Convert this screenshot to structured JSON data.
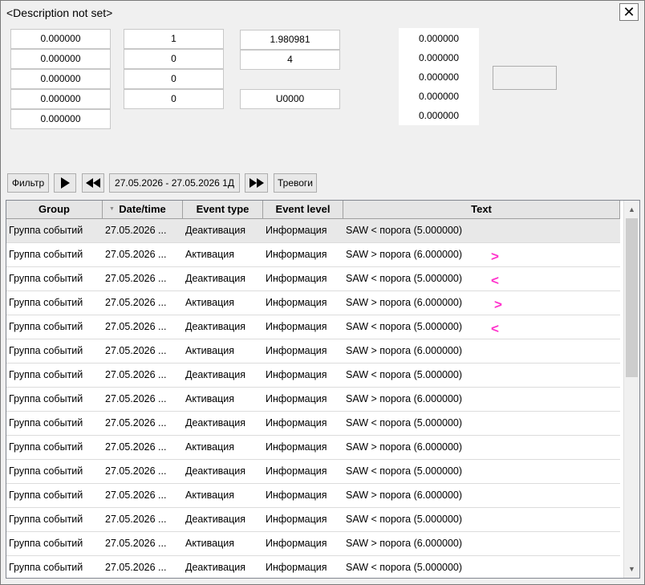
{
  "window": {
    "title": "<Description not set>",
    "close_glyph": "✕"
  },
  "fields": {
    "col1": [
      "0.000000",
      "0.000000",
      "0.000000",
      "0.000000",
      "0.000000"
    ],
    "col2": [
      "1",
      "0",
      "0",
      "0"
    ],
    "col3": [
      "1.980981",
      "4"
    ],
    "col3_extra": "U0000",
    "col4": [
      "0.000000",
      "0.000000",
      "0.000000",
      "0.000000",
      "0.000000"
    ]
  },
  "toolbar": {
    "filter_label": "Фильтр",
    "play_icon": "play-icon",
    "rewind_icon": "rewind-icon",
    "date_range": "27.05.2026 - 27.05.2026 1Д",
    "forward_icon": "fast-forward-icon",
    "alarms_label": "Тревоги"
  },
  "table": {
    "columns": [
      "Group",
      "Date/time",
      "Event type",
      "Event level",
      "Text"
    ],
    "sorted_column": "Date/time",
    "rows": [
      [
        "Группа событий",
        "27.05.2026 ...",
        "Деактивация",
        "Информация",
        "SAW < порога (5.000000)"
      ],
      [
        "Группа событий",
        "27.05.2026 ...",
        "Активация",
        "Информация",
        "SAW > порога (6.000000)"
      ],
      [
        "Группа событий",
        "27.05.2026 ...",
        "Деактивация",
        "Информация",
        "SAW < порога (5.000000)"
      ],
      [
        "Группа событий",
        "27.05.2026 ...",
        "Активация",
        "Информация",
        "SAW > порога (6.000000)"
      ],
      [
        "Группа событий",
        "27.05.2026 ...",
        "Деактивация",
        "Информация",
        "SAW < порога (5.000000)"
      ],
      [
        "Группа событий",
        "27.05.2026 ...",
        "Активация",
        "Информация",
        "SAW > порога (6.000000)"
      ],
      [
        "Группа событий",
        "27.05.2026 ...",
        "Деактивация",
        "Информация",
        "SAW < порога (5.000000)"
      ],
      [
        "Группа событий",
        "27.05.2026 ...",
        "Активация",
        "Информация",
        "SAW > порога (6.000000)"
      ],
      [
        "Группа событий",
        "27.05.2026 ...",
        "Деактивация",
        "Информация",
        "SAW < порога (5.000000)"
      ],
      [
        "Группа событий",
        "27.05.2026 ...",
        "Активация",
        "Информация",
        "SAW > порога (6.000000)"
      ],
      [
        "Группа событий",
        "27.05.2026 ...",
        "Деактивация",
        "Информация",
        "SAW < порога (5.000000)"
      ],
      [
        "Группа событий",
        "27.05.2026 ...",
        "Активация",
        "Информация",
        "SAW > порога (6.000000)"
      ],
      [
        "Группа событий",
        "27.05.2026 ...",
        "Деактивация",
        "Информация",
        "SAW < порога (5.000000)"
      ],
      [
        "Группа событий",
        "27.05.2026 ...",
        "Активация",
        "Информация",
        "SAW > порога (6.000000)"
      ],
      [
        "Группа событий",
        "27.05.2026 ...",
        "Деактивация",
        "Информация",
        "SAW < порога (5.000000)"
      ]
    ],
    "selected_row": 0
  },
  "annotations": {
    "marks": [
      ">",
      "<",
      ">",
      "<"
    ],
    "color": "#ff33cc"
  }
}
